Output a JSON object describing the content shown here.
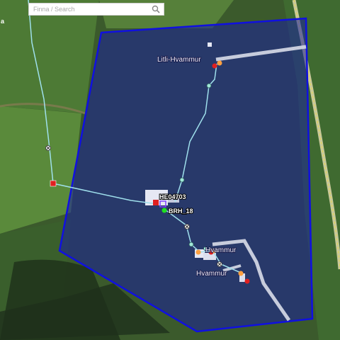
{
  "search": {
    "placeholder": "Finna / Search"
  },
  "corner_text": "a",
  "labels": {
    "place_north": "Litli-Hvammur",
    "place_south_1": "Hvammur",
    "place_south_2": "Hvammur",
    "station_1": "HE04703",
    "station_2": "BRH_18"
  },
  "colors": {
    "polygon_stroke": "#1010e0",
    "polygon_fill": "#1a1f9e",
    "pipe": "#9fe0ec",
    "node": "#a0e8d8",
    "marker_red": "#e02020",
    "marker_orange": "#ffa040",
    "marker_green": "#20e020",
    "road": "#d8dce8"
  },
  "icons": [
    "search-icon",
    "valve-icon"
  ]
}
